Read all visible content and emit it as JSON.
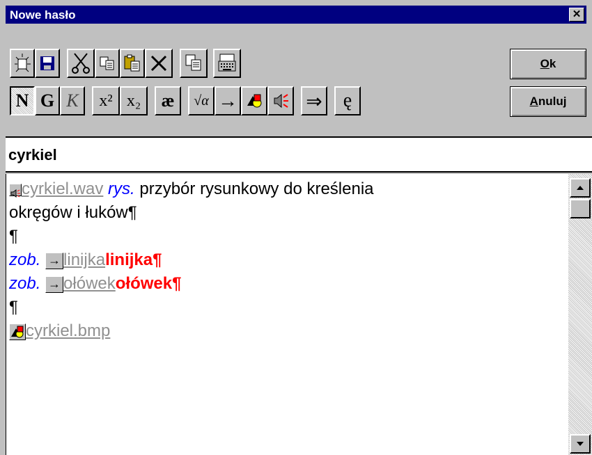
{
  "window": {
    "title": "Nowe hasło",
    "close_glyph": "✕"
  },
  "toolbar": {
    "row1": [
      {
        "name": "new-icon",
        "glyph": "☼"
      },
      {
        "name": "save-icon",
        "glyph": ""
      },
      {
        "name": "cut-icon",
        "glyph": "✂"
      },
      {
        "name": "copy-icon",
        "glyph": "⎘"
      },
      {
        "name": "paste-icon",
        "glyph": "📋"
      },
      {
        "name": "delete-icon",
        "glyph": "✕"
      },
      {
        "name": "copy-format-icon",
        "glyph": "⎘"
      },
      {
        "name": "keyboard-icon",
        "glyph": "⌨"
      }
    ],
    "row2": [
      {
        "name": "normal-button",
        "label": "N"
      },
      {
        "name": "bold-button",
        "label": "G"
      },
      {
        "name": "italic-button",
        "label": "K"
      },
      {
        "name": "superscript-button",
        "label": "x²"
      },
      {
        "name": "subscript-button",
        "label": "x₂"
      },
      {
        "name": "special-char-button",
        "label": "æ"
      },
      {
        "name": "formula-button",
        "label": "√α"
      },
      {
        "name": "link-arrow-button",
        "label": "→"
      },
      {
        "name": "image-button",
        "label": ""
      },
      {
        "name": "sound-button",
        "label": "🔊"
      },
      {
        "name": "double-arrow-button",
        "label": "⇒"
      },
      {
        "name": "e-ogonek-button",
        "label": "ę"
      }
    ],
    "ok_label": "Ok",
    "ok_underline": "O",
    "ok_rest": "k",
    "cancel_underline": "A",
    "cancel_rest": "nuluj"
  },
  "headword": "cyrkiel",
  "content": {
    "sound_file": "cyrkiel.wav",
    "abbrev": "rys.",
    "definition_part1": " przybór rysunkowy do kreślenia",
    "definition_part2": "okręgów i łuków¶",
    "pilcrow": "¶",
    "see_label": "zob.",
    "link1_target": "linijka",
    "link1_text": "linijka¶",
    "link2_target": "ołówek",
    "link2_text": "ołówek¶",
    "image_file": "cyrkiel.bmp"
  }
}
